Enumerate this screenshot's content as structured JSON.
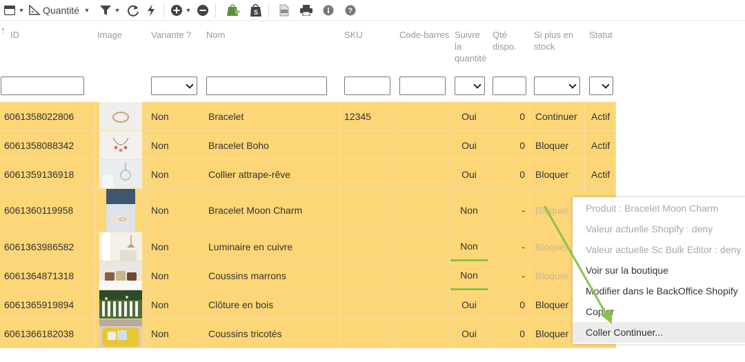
{
  "toolbar": {
    "items": [
      {
        "icon": "grid-view-icon"
      },
      {
        "icon": "measure-icon",
        "label": "Quantité"
      },
      {
        "icon": "filter-icon"
      },
      {
        "icon": "refresh-icon"
      },
      {
        "icon": "lightning-icon"
      },
      {
        "icon": "add-icon"
      },
      {
        "icon": "remove-icon"
      },
      {
        "icon": "shopify-sync-icon"
      },
      {
        "icon": "shopify-bag-icon"
      },
      {
        "icon": "csv-icon"
      },
      {
        "icon": "print-icon"
      },
      {
        "icon": "info-icon"
      },
      {
        "icon": "help-icon"
      }
    ],
    "quantity_label": "Quantité"
  },
  "table": {
    "columns": [
      "ID",
      "Image",
      "Variante ?",
      "Nom",
      "SKU",
      "Code-barres",
      "Suivre la quantité",
      "Qté dispo.",
      "Si plus en stock",
      "Statut"
    ],
    "sort_indicator": "↑",
    "rows": [
      {
        "id": "6061358022806",
        "variante": "Non",
        "nom": "Bracelet",
        "sku": "12345",
        "barcode": "",
        "suivre": "Oui",
        "qte": "0",
        "stock": "Continuer",
        "statut": "Actif"
      },
      {
        "id": "6061358088342",
        "variante": "Non",
        "nom": "Bracelet Boho",
        "sku": "",
        "barcode": "",
        "suivre": "Oui",
        "qte": "0",
        "stock": "Bloquer",
        "statut": "Actif"
      },
      {
        "id": "6061359136918",
        "variante": "Non",
        "nom": "Collier attrape-rêve",
        "sku": "",
        "barcode": "",
        "suivre": "Oui",
        "qte": "0",
        "stock": "Bloquer",
        "statut": "Actif"
      },
      {
        "id": "6061360119958",
        "variante": "Non",
        "nom": "Bracelet Moon Charm",
        "sku": "",
        "barcode": "",
        "suivre": "Non",
        "qte": "-",
        "stock": "Bloquer",
        "statut": ""
      },
      {
        "id": "6061363986582",
        "variante": "Non",
        "nom": "Luminaire en cuivre",
        "sku": "",
        "barcode": "",
        "suivre": "Non",
        "qte": "-",
        "stock": "Bloquer",
        "statut": ""
      },
      {
        "id": "6061364871318",
        "variante": "Non",
        "nom": "Coussins marrons",
        "sku": "",
        "barcode": "",
        "suivre": "Non",
        "qte": "-",
        "stock": "Bloquer",
        "statut": ""
      },
      {
        "id": "6061365919894",
        "variante": "Non",
        "nom": "Clôture en bois",
        "sku": "",
        "barcode": "",
        "suivre": "Oui",
        "qte": "0",
        "stock": "Bloquer",
        "statut": ""
      },
      {
        "id": "6061366182038",
        "variante": "Non",
        "nom": "Coussins tricotés",
        "sku": "",
        "barcode": "",
        "suivre": "Oui",
        "qte": "0",
        "stock": "Bloquer",
        "statut": ""
      }
    ]
  },
  "context_menu": {
    "items": [
      {
        "label": "Produit : Bracelet Moon Charm",
        "disabled": true
      },
      {
        "label": "Valeur actuelle Shopify : deny",
        "disabled": true
      },
      {
        "label": "Valeur actuelle Sc Bulk Editor : deny",
        "disabled": true
      },
      {
        "label": "Voir sur la boutique",
        "disabled": false
      },
      {
        "label": "Modifier dans le BackOffice Shopify",
        "disabled": false
      },
      {
        "label": "Copier",
        "disabled": false
      },
      {
        "label": "Coller Continuer...",
        "disabled": false,
        "highlighted": true
      }
    ]
  },
  "colors": {
    "row_bg": "#fdd677",
    "selection_border": "#8fbf3f",
    "arrow": "#8bc34a",
    "header_text": "#999999"
  }
}
